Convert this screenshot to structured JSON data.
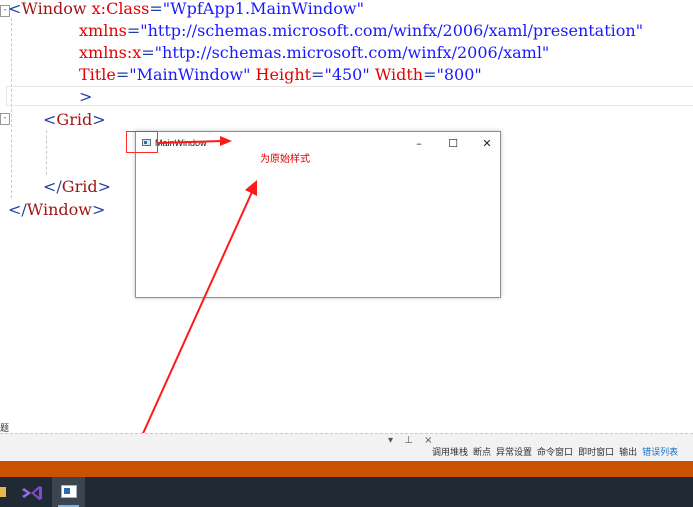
{
  "code": {
    "line1_tag": "Window",
    "line1_attr": "x:Class",
    "line1_val": "\"WpfApp1.MainWindow\"",
    "line2_attr": "xmlns",
    "line2_val": "\"http://schemas.microsoft.com/winfx/2006/xaml/presentation\"",
    "line3_attr": "xmlns:x",
    "line3_val": "\"http://schemas.microsoft.com/winfx/2006/xaml\"",
    "line4_attr1": "Title",
    "line4_val1": "\"MainWindow\"",
    "line4_attr2": "Height",
    "line4_val2": "\"450\"",
    "line4_attr3": "Width",
    "line4_val3": "\"800\"",
    "line6_tag": "Grid",
    "line9_tag": "Grid",
    "line10_tag": "Window"
  },
  "preview_window": {
    "title": "MainWindow",
    "minimize_glyph": "–",
    "maximize_glyph": "☐",
    "close_glyph": "✕"
  },
  "annotation": {
    "note": "为原始样式"
  },
  "bottom_panel": {
    "partial_label": "题",
    "controls": "▾ ⊥ ×",
    "tabs": [
      "调用堆栈",
      "断点",
      "异常设置",
      "命令窗口",
      "即时窗口",
      "输出",
      "错误列表"
    ],
    "active_tab": "错误列表"
  },
  "colors": {
    "status_bar": "#ca5100",
    "taskbar": "#1f2a34",
    "annotation_red": "#ff0000"
  }
}
